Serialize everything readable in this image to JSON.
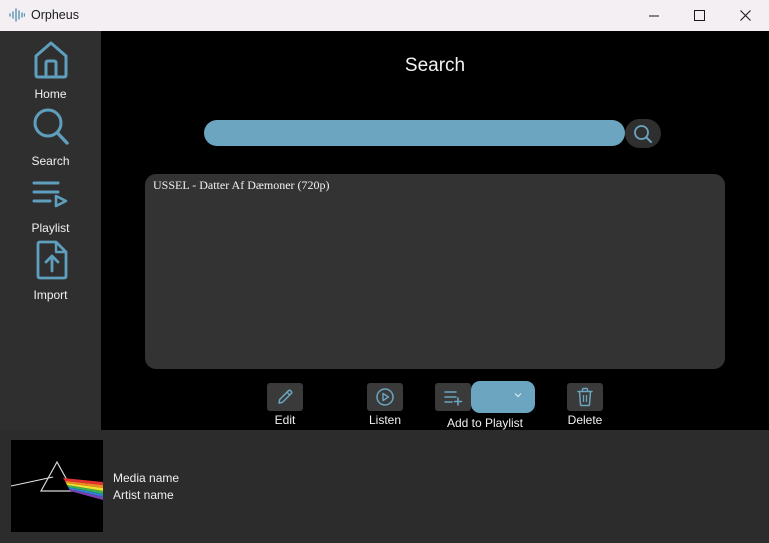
{
  "window": {
    "title": "Orpheus",
    "controls": {
      "minimize": "minimize-icon",
      "maximize": "maximize-icon",
      "close": "close-icon"
    }
  },
  "sidebar": {
    "items": [
      {
        "label": "Home",
        "icon": "home-icon"
      },
      {
        "label": "Search",
        "icon": "search-icon"
      },
      {
        "label": "Playlist",
        "icon": "playlist-icon"
      },
      {
        "label": "Import",
        "icon": "import-icon"
      }
    ]
  },
  "main": {
    "title": "Search",
    "search": {
      "value": "",
      "button_icon": "search-icon"
    },
    "results": [
      {
        "text": "USSEL - Datter Af Dæmoner (720p)"
      }
    ],
    "actions": {
      "edit": "Edit",
      "listen": "Listen",
      "add_to_playlist": "Add to Playlist",
      "delete": "Delete"
    },
    "playlist_select": {
      "value": ""
    }
  },
  "player": {
    "media_name": "Media name",
    "artist_name": "Artist name",
    "album_art": "prism-album-art"
  },
  "colors": {
    "accent": "#6ba5c0",
    "sidebar_bg": "#2f2f2f",
    "main_bg": "#000000",
    "panel_bg": "#333333",
    "player_bg": "#2c2c2c",
    "titlebar_bg": "#f3eff3"
  }
}
